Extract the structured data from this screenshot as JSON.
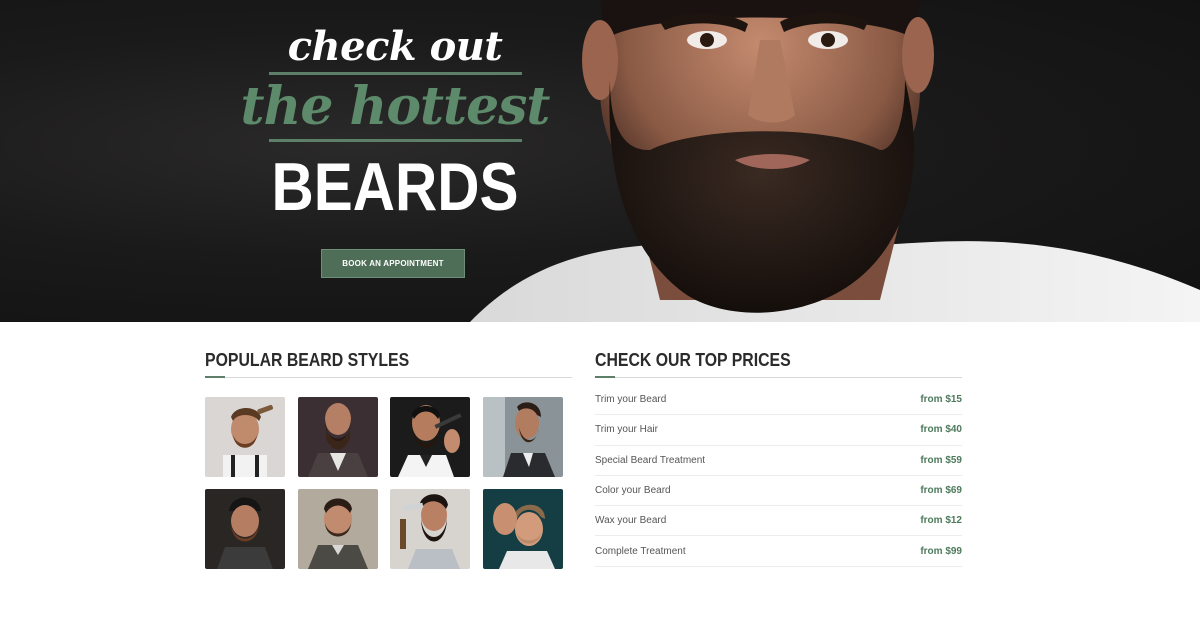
{
  "hero": {
    "line1": "check out",
    "line2": "the hottest",
    "line3": "BEARDS",
    "cta_label": "BOOK AN APPOINTMENT"
  },
  "styles": {
    "title": "POPULAR BEARD STYLES",
    "thumbnails": [
      {
        "icon": "man-combing-hair-photo"
      },
      {
        "icon": "bearded-man-vest-photo"
      },
      {
        "icon": "beard-trimming-photo"
      },
      {
        "icon": "bearded-man-profile-photo"
      },
      {
        "icon": "man-beanie-photo"
      },
      {
        "icon": "man-short-beard-photo"
      },
      {
        "icon": "man-straight-razor-photo"
      },
      {
        "icon": "man-hair-styling-photo"
      }
    ]
  },
  "prices": {
    "title": "CHECK OUR TOP PRICES",
    "items": [
      {
        "name": "Trim your Beard",
        "price": "from $15"
      },
      {
        "name": "Trim your Hair",
        "price": "from $40"
      },
      {
        "name": "Special Beard Treatment",
        "price": "from $59"
      },
      {
        "name": "Color your Beard",
        "price": "from $69"
      },
      {
        "name": "Wax your Beard",
        "price": "from $12"
      },
      {
        "name": "Complete Treatment",
        "price": "from $99"
      }
    ]
  },
  "colors": {
    "accent": "#5d7f69",
    "button": "#4e6e57",
    "price": "#4e7a5c",
    "hero_bg": "#1b1a1a"
  }
}
